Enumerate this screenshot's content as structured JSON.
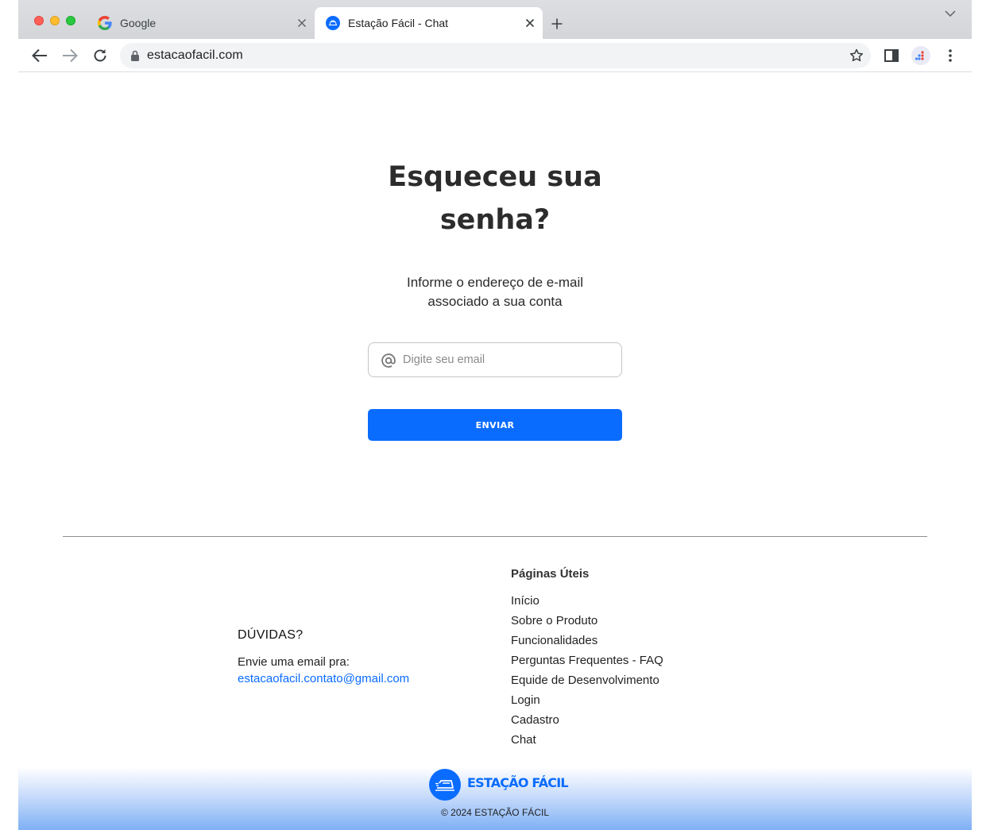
{
  "browser": {
    "tabs": [
      {
        "title": "Google",
        "icon": "google-g-icon",
        "active": false
      },
      {
        "title": "Estação Fácil - Chat",
        "icon": "estacao-facil-favicon",
        "active": true
      }
    ],
    "address_bar": {
      "url": "estacaofacil.com"
    }
  },
  "page": {
    "heading_line1": "Esqueceu sua",
    "heading_line2": "senha?",
    "subtitle_line1": "Informe o endereço de e-mail",
    "subtitle_line2": "associado a sua conta",
    "email_field": {
      "placeholder": "Digite seu email",
      "value": ""
    },
    "submit_label": "ENVIAR"
  },
  "footer": {
    "doubts": {
      "title": "DÚVIDAS?",
      "text": "Envie uma email pra:",
      "email": "estacaofacil.contato@gmail.com"
    },
    "useful_pages": {
      "title": "Páginas Úteis",
      "links": [
        "Início",
        "Sobre o Produto",
        "Funcionalidades",
        "Perguntas Frequentes - FAQ",
        "Equide de Desenvolvimento",
        "Login",
        "Cadastro",
        "Chat"
      ]
    },
    "logo_text": "ESTAÇÃO FÁCIL",
    "copyright": "© 2024 ESTAÇÃO FÁCIL"
  },
  "colors": {
    "brand_blue": "#0a6cff",
    "heading": "#2c2c2c"
  }
}
